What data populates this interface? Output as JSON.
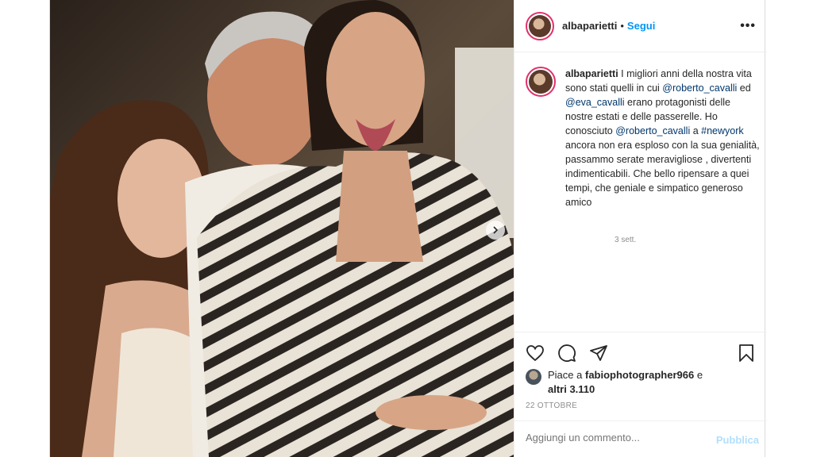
{
  "header": {
    "username": "albaparietti",
    "separator": "•",
    "follow_label": "Segui",
    "more_label": "•••"
  },
  "caption": {
    "username": "albaparietti",
    "segments": {
      "t1": " I migliori anni della nostra vita sono stati quelli in cui ",
      "m1": "@roberto_cavalli",
      "t2": " ed ",
      "m2": "@eva_cavalli",
      "t3": " erano protagonisti delle nostre estati e delle passerelle. Ho conosciuto ",
      "m3": "@roberto_cavalli",
      "t4": " a ",
      "m4": "#newyork",
      "t5": " ancora non era esploso con la sua genialità, passammo serate meravigliose , divertenti indimenticabili. Che bello ripensare a quei tempi, che geniale e simpatico generoso amico"
    },
    "time_ago": "3 sett."
  },
  "actions": {
    "like_icon": "heart-icon",
    "comment_icon": "comment-icon",
    "share_icon": "paper-plane-icon",
    "save_icon": "bookmark-icon"
  },
  "likes": {
    "prefix": "Piace a ",
    "user": "fabiophotographer966",
    "mid": " e",
    "others": "altri 3.110"
  },
  "date": "22 OTTOBRE",
  "comment": {
    "placeholder": "Aggiungi un commento...",
    "publish_label": "Pubblica"
  },
  "colors": {
    "accent": "#0095f6",
    "mention": "#00376b",
    "publish_disabled": "#b2dffc",
    "muted": "#8e8e8e",
    "story_ring": "#e1306c"
  },
  "photo": {
    "carousel_icon": "chevron-right-icon"
  }
}
